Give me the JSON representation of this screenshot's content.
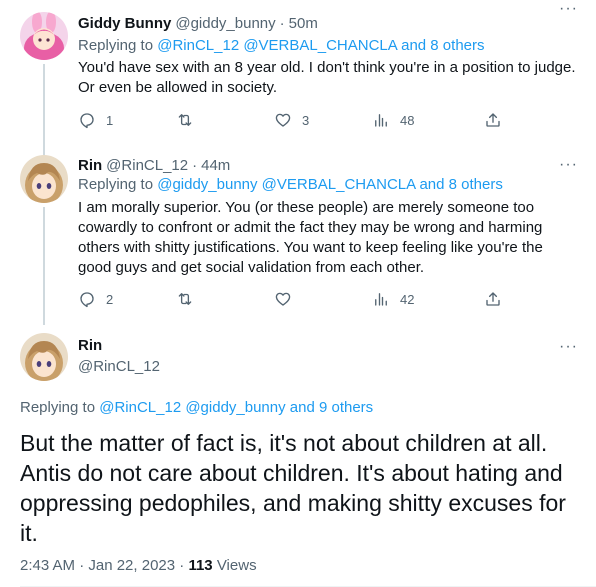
{
  "tweets": [
    {
      "name": "Giddy Bunny",
      "handle": "@giddy_bunny",
      "time": "50m",
      "replying_prefix": "Replying to",
      "replying_to": "@RinCL_12 @VERBAL_CHANCLA and 8 others",
      "text": "You'd have sex with an 8 year old. I don't think you're in a position to judge. Or even be allowed in society.",
      "replies": "1",
      "retweets": "",
      "likes": "3",
      "views": "48"
    },
    {
      "name": "Rin",
      "handle": "@RinCL_12",
      "time": "44m",
      "replying_prefix": "Replying to",
      "replying_to": "@giddy_bunny @VERBAL_CHANCLA and 8 others",
      "text": "I am morally superior. You (or these people) are merely someone too cowardly to confront or admit the fact they may be wrong and harming others with shitty justifications. You want to keep feeling like you're the good guys and get social validation from each other.",
      "replies": "2",
      "retweets": "",
      "likes": "",
      "views": "42"
    }
  ],
  "main": {
    "name": "Rin",
    "handle": "@RinCL_12",
    "replying_prefix": "Replying to",
    "replying_to": "@RinCL_12 @giddy_bunny and 9 others",
    "text": "But the matter of fact is, it's not about children at all. Antis do not care about children. It's about hating and oppressing pedophiles, and making shitty excuses for it.",
    "timestamp": "2:43 AM · Jan 22, 2023 ·",
    "views_count": "113",
    "views_label": "Views"
  },
  "separator": "·",
  "more_label": "···",
  "icons": {
    "reply": "reply-icon",
    "retweet": "retweet-icon",
    "like": "heart-icon",
    "views": "analytics-icon",
    "share": "share-icon",
    "more": "more-icon"
  },
  "colors": {
    "link": "#1d9bf0",
    "secondary": "#536471",
    "text": "#0f1419",
    "line": "#cfd9de"
  }
}
